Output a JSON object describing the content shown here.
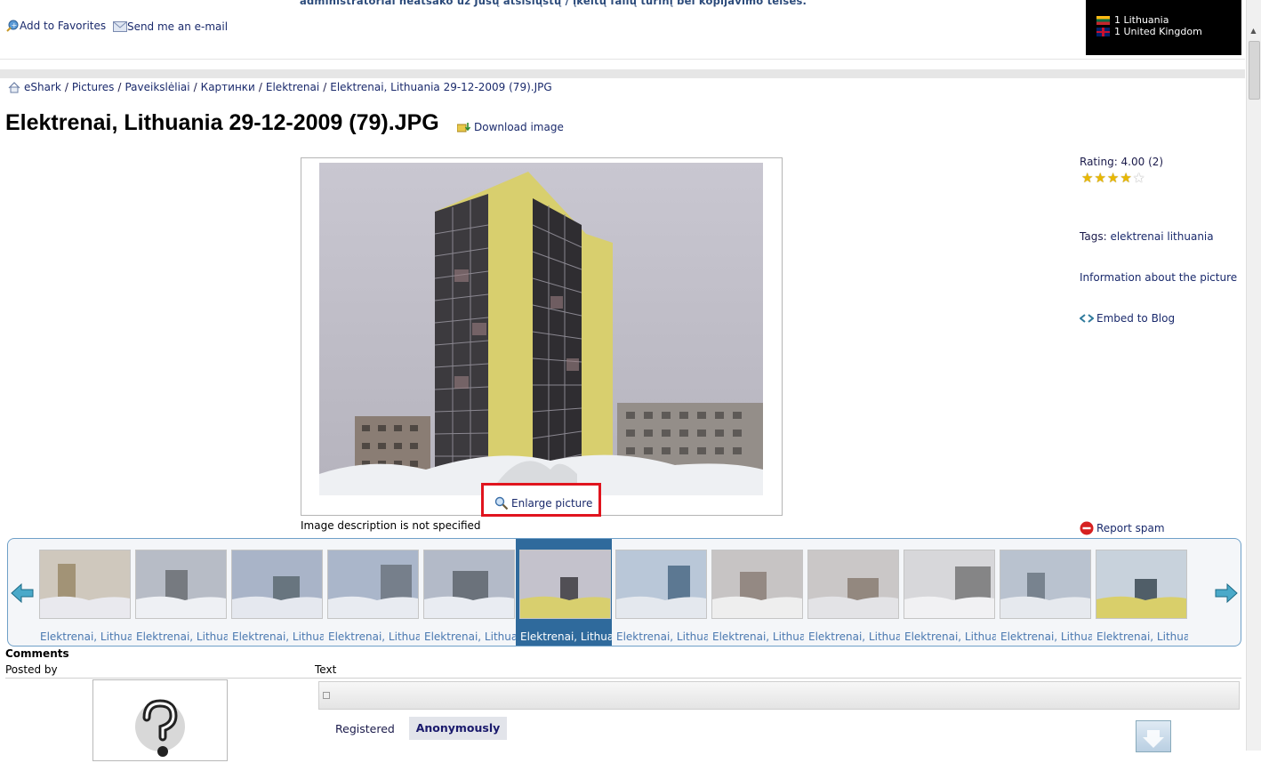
{
  "header": {
    "notice": "administratoriai neatsako už Jūsų atsisiųstų / įkeltų failų turinį bei kopijavimo teises.",
    "add_favorites": "Add to Favorites",
    "send_email": "Send me an e-mail",
    "visitors": [
      {
        "count_country": "1 Lithuania",
        "flag": "lt"
      },
      {
        "count_country": "1 United Kingdom",
        "flag": "gb"
      }
    ]
  },
  "breadcrumb": [
    "eShark",
    "Pictures",
    "Paveikslėliai",
    "Картинки",
    "Elektrenai",
    "Elektrenai, Lithuania 29-12-2009 (79).JPG"
  ],
  "breadcrumb_sep": "/",
  "title": "Elektrenai, Lithuania 29-12-2009 (79).JPG",
  "download_label": "Download image",
  "enlarge_label": "Enlarge picture",
  "image_description": "Image description is not specified",
  "rating": {
    "text": "Rating: 4.00 (2)",
    "value": 4,
    "max": 5
  },
  "tags": {
    "label": "Tags:",
    "items": [
      "elektrenai",
      "lithuania"
    ]
  },
  "info_link": "Information about the picture",
  "embed_label": "Embed to Blog",
  "report_label": "Report spam",
  "thumbnails": {
    "label": "Elektrenai, Lithuania",
    "active_index": 5,
    "count": 12
  },
  "comments": {
    "heading": "Comments",
    "posted_by": "Posted by",
    "text": "Text",
    "tab_registered": "Registered",
    "tab_anonymous": "Anonymously"
  },
  "colors": {
    "accent": "#2f6a9c",
    "highlight": "#e0141e",
    "link": "#1a2a6c"
  }
}
